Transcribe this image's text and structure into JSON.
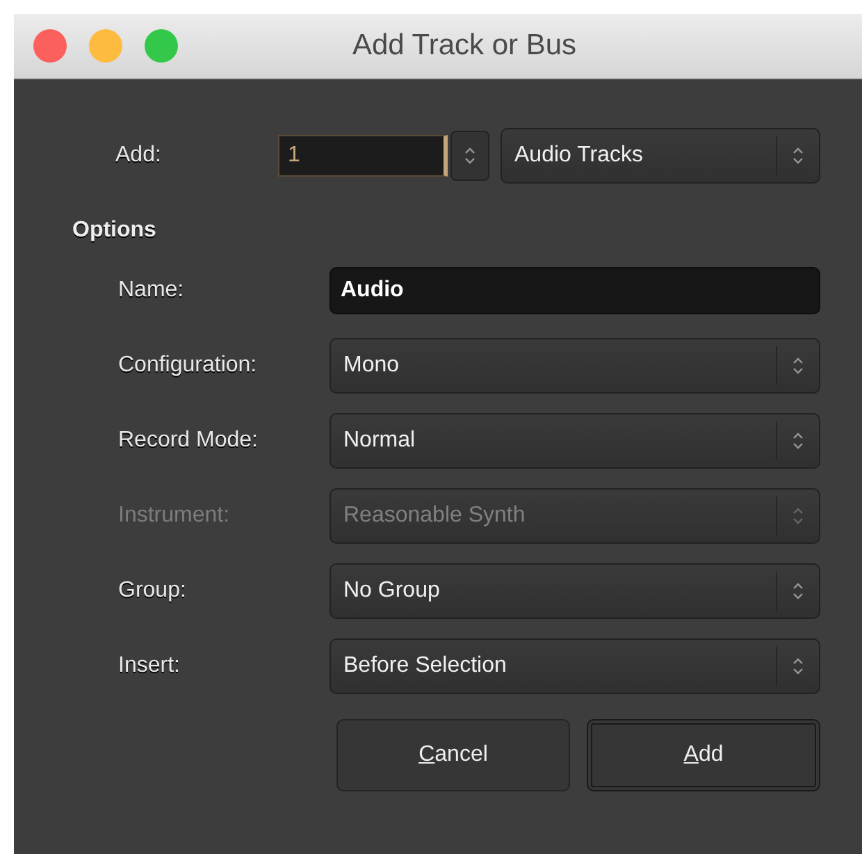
{
  "window": {
    "title": "Add Track or Bus"
  },
  "add": {
    "label": "Add:",
    "count": "1",
    "type": "Audio Tracks"
  },
  "options": {
    "heading": "Options",
    "rows": [
      {
        "kind": "text",
        "label": "Name:",
        "value": "Audio",
        "disabled": false
      },
      {
        "kind": "select",
        "label": "Configuration:",
        "value": "Mono",
        "disabled": false
      },
      {
        "kind": "select",
        "label": "Record Mode:",
        "value": "Normal",
        "disabled": false
      },
      {
        "kind": "select",
        "label": "Instrument:",
        "value": "Reasonable Synth",
        "disabled": true
      },
      {
        "kind": "select",
        "label": "Group:",
        "value": "No Group",
        "disabled": false
      },
      {
        "kind": "select",
        "label": "Insert:",
        "value": "Before Selection",
        "disabled": false
      }
    ]
  },
  "buttons": [
    {
      "label": "Cancel",
      "default": false
    },
    {
      "label": "Add",
      "default": true
    }
  ]
}
